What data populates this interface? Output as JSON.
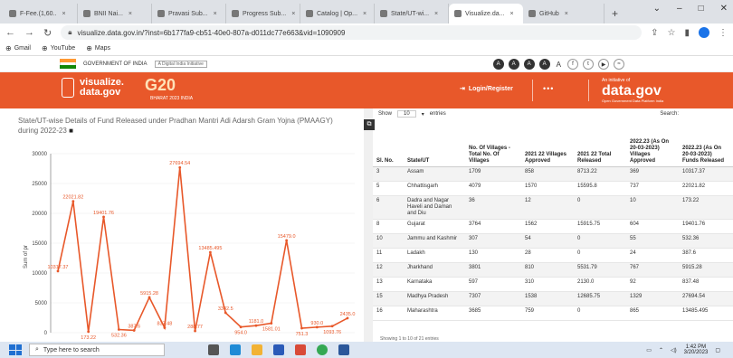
{
  "browser": {
    "tabs": [
      "F-Fee.(1,60..",
      "BNII Nai...",
      "Pravasi Sub...",
      "Progress Sub...",
      "Catalog | Op...",
      "State/UT-wi...",
      "Visualize.da...",
      "GitHub"
    ],
    "active_tab": 6,
    "new_tab": "+",
    "url": "visualize.data.gov.in/?inst=6b177fa9-cb51-40e0-807a-d011dc77e663&vid=1090909",
    "bookmarks": [
      "Gmail",
      "YouTube",
      "Maps"
    ]
  },
  "goi": {
    "label": "GOVERNMENT OF INDIA",
    "tag": "A Digital India Initiative",
    "circles": [
      "A",
      "A",
      "A",
      "A"
    ],
    "font_label": "A"
  },
  "header": {
    "brand_line1": "visualize.",
    "brand_line2": "data.gov",
    "g20": "G20",
    "g20_sub": "BHARAT 2023 INDIA",
    "login": "Login/Register",
    "dots": "•••",
    "initiative": "An initiative of",
    "dgov": "data.gov",
    "dgov_sub": "Open Government Data Platform India"
  },
  "chart_data": {
    "type": "line",
    "title": "State/UT-wise Details of Fund Released under Pradhan Mantri Adi Adarsh Gram Yojna (PMAAGY) during 2022-23",
    "ylabel": "Sum of pr",
    "ylim": [
      0,
      30000
    ],
    "yticks": [
      0,
      5000,
      10000,
      15000,
      20000,
      25000,
      30000
    ],
    "color": "#e8582a",
    "values": [
      10317.37,
      22021.82,
      173.22,
      19401.76,
      532.36,
      387.6,
      5915.28,
      837.48,
      27694.54,
      288.77,
      13485.495,
      3342.5,
      954.0,
      1181.0,
      1581.01,
      15479.0,
      751.3,
      930.0,
      1093.76,
      2435.0
    ],
    "labels": [
      {
        "i": 0,
        "text": "10317.37"
      },
      {
        "i": 1,
        "text": "22021.82"
      },
      {
        "i": 2,
        "text": "173.22"
      },
      {
        "i": 3,
        "text": "19401.76"
      },
      {
        "i": 4,
        "text": "532.36"
      },
      {
        "i": 5,
        "text": "387.6"
      },
      {
        "i": 6,
        "text": "5915.28"
      },
      {
        "i": 7,
        "text": "837.48"
      },
      {
        "i": 8,
        "text": "27694.54"
      },
      {
        "i": 9,
        "text": "288.77"
      },
      {
        "i": 10,
        "text": "13485.495"
      },
      {
        "i": 11,
        "text": "3342.5"
      },
      {
        "i": 12,
        "text": "954.0"
      },
      {
        "i": 13,
        "text": "1181.0"
      },
      {
        "i": 14,
        "text": "1581.01"
      },
      {
        "i": 15,
        "text": "15479.0"
      },
      {
        "i": 16,
        "text": "751.3"
      },
      {
        "i": 17,
        "text": "930.0"
      },
      {
        "i": 18,
        "text": "1093.76"
      },
      {
        "i": 19,
        "text": "2435.0"
      }
    ]
  },
  "table": {
    "show_label": "Show",
    "show_value": "10",
    "entries_label": "entries",
    "search_label": "Search:",
    "columns": [
      "Sl. No.",
      "State/UT",
      "No. Of Villages - Total No. Of Villages",
      "2021 22 Villages Approved",
      "2021 22 Total Released",
      "2022.23 (As On 20-03-2023) Villages Approved",
      "2022.23 (As On 20-03-2023) Funds Released"
    ],
    "rows": [
      [
        "3",
        "Assam",
        "1709",
        "858",
        "8713.22",
        "369",
        "10317.37"
      ],
      [
        "5",
        "Chhattisgarh",
        "4079",
        "1570",
        "15595.8",
        "737",
        "22021.82"
      ],
      [
        "6",
        "Dadra and Nagar Haveli and Daman and Diu",
        "36",
        "12",
        "0",
        "10",
        "173.22"
      ],
      [
        "8",
        "Gujarat",
        "3764",
        "1562",
        "15915.75",
        "604",
        "19401.76"
      ],
      [
        "10",
        "Jammu and Kashmir",
        "307",
        "54",
        "0",
        "55",
        "532.36"
      ],
      [
        "11",
        "Ladakh",
        "130",
        "28",
        "0",
        "24",
        "387.6"
      ],
      [
        "12",
        "Jharkhand",
        "3801",
        "810",
        "5531.79",
        "767",
        "5915.28"
      ],
      [
        "13",
        "Karnataka",
        "597",
        "310",
        "2130.0",
        "92",
        "837.48"
      ],
      [
        "15",
        "Madhya Pradesh",
        "7307",
        "1538",
        "12685.75",
        "1329",
        "27694.54"
      ],
      [
        "16",
        "Maharashtra",
        "3685",
        "759",
        "0",
        "865",
        "13485.495"
      ]
    ],
    "footer": "Showing 1 to 10 of 21 entries"
  },
  "taskbar": {
    "search": "Type here to search",
    "time": "1:42 PM",
    "date": "3/20/2023"
  }
}
